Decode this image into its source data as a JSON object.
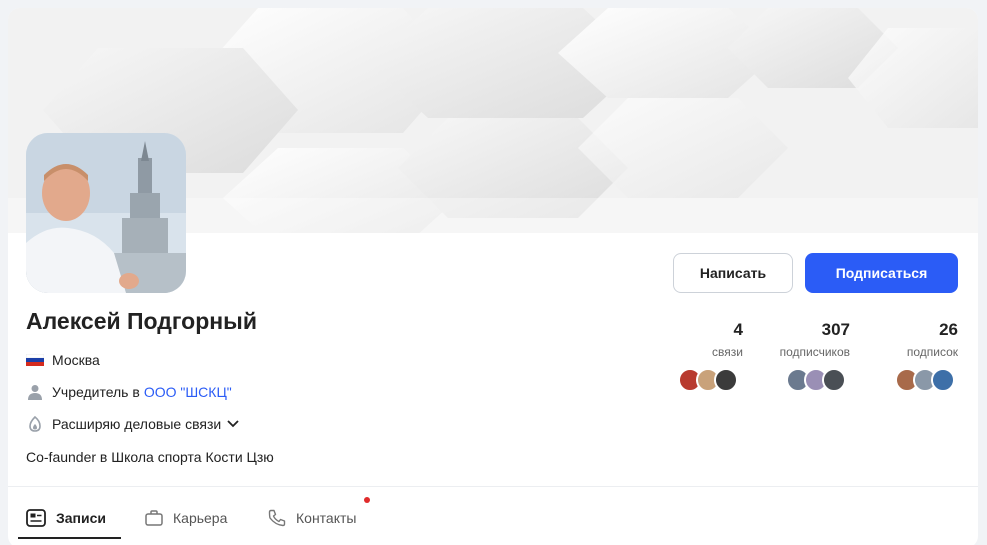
{
  "profile": {
    "name": "Алексей Подгорный",
    "location": "Москва",
    "position_prefix": "Учредитель в",
    "company": "ООО \"ШСКЦ\"",
    "goal": "Расширяю деловые связи",
    "about": "Co-faunder в Школа спорта Кости Цзю"
  },
  "actions": {
    "write_label": "Написать",
    "subscribe_label": "Подписаться"
  },
  "stats": [
    {
      "value": "4",
      "label": "связи",
      "faces": [
        "#b83a2e",
        "#c9a27a",
        "#3b3b3b"
      ]
    },
    {
      "value": "307",
      "label": "подписчиков",
      "faces": [
        "#6b7a8f",
        "#9a8fb5",
        "#4a4f55"
      ]
    },
    {
      "value": "26",
      "label": "подписок",
      "faces": [
        "#a86a4a",
        "#8a98a8",
        "#3d6fa8"
      ]
    }
  ],
  "tabs": [
    {
      "label": "Записи",
      "icon": "posts-icon"
    },
    {
      "label": "Карьера",
      "icon": "briefcase-icon"
    },
    {
      "label": "Контакты",
      "icon": "phone-icon"
    }
  ],
  "colors": {
    "accent": "#2b5cf6",
    "notification_dot": "#e02b2b"
  }
}
